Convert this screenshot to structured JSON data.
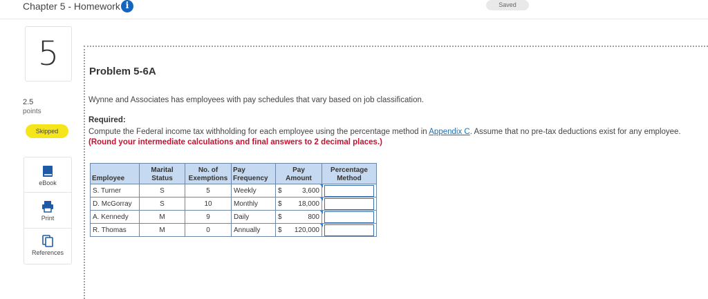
{
  "header": {
    "title": "Chapter 5 - Homework",
    "info_icon": "i",
    "saved_label": "Saved"
  },
  "sidebar": {
    "question_number": "5",
    "points_value": "2.5",
    "points_label": "points",
    "status_badge": "Skipped",
    "tools": [
      {
        "label": "eBook",
        "icon": "book-icon"
      },
      {
        "label": "Print",
        "icon": "printer-icon"
      },
      {
        "label": "References",
        "icon": "references-icon"
      }
    ]
  },
  "problem": {
    "title": "Problem 5-6A",
    "description": "Wynne and Associates has employees with pay schedules that vary based on job classification.",
    "required_heading": "Required:",
    "required_text_before": "Compute the Federal income tax withholding for each employee using the percentage method in ",
    "required_link": "Appendix C",
    "required_text_after": ". Assume that no pre-tax deductions exist for any employee. ",
    "required_emphasis": "(Round your intermediate calculations and final answers to 2 decimal places.)"
  },
  "table": {
    "headers": {
      "employee": "Employee",
      "status_l1": "Marital",
      "status_l2": "Status",
      "exemptions_l1": "No. of",
      "exemptions_l2": "Exemptions",
      "frequency_l1": "Pay",
      "frequency_l2": "Frequency",
      "amount_l1": "Pay",
      "amount_l2": "Amount",
      "percentage_l1": "Percentage",
      "percentage_l2": "Method"
    },
    "rows": [
      {
        "employee": "S. Turner",
        "status": "S",
        "exemptions": "5",
        "frequency": "Weekly",
        "currency": "$",
        "amount": "3,600",
        "percentage": ""
      },
      {
        "employee": "D. McGorray",
        "status": "S",
        "exemptions": "10",
        "frequency": "Monthly",
        "currency": "$",
        "amount": "18,000",
        "percentage": ""
      },
      {
        "employee": "A. Kennedy",
        "status": "M",
        "exemptions": "9",
        "frequency": "Daily",
        "currency": "$",
        "amount": "800",
        "percentage": ""
      },
      {
        "employee": "R. Thomas",
        "status": "M",
        "exemptions": "0",
        "frequency": "Annually",
        "currency": "$",
        "amount": "120,000",
        "percentage": ""
      }
    ]
  },
  "colors": {
    "accent": "#1565c0",
    "badge": "#f5e61c",
    "table_header": "#c5d9f1",
    "emphasis": "#c8102e"
  }
}
